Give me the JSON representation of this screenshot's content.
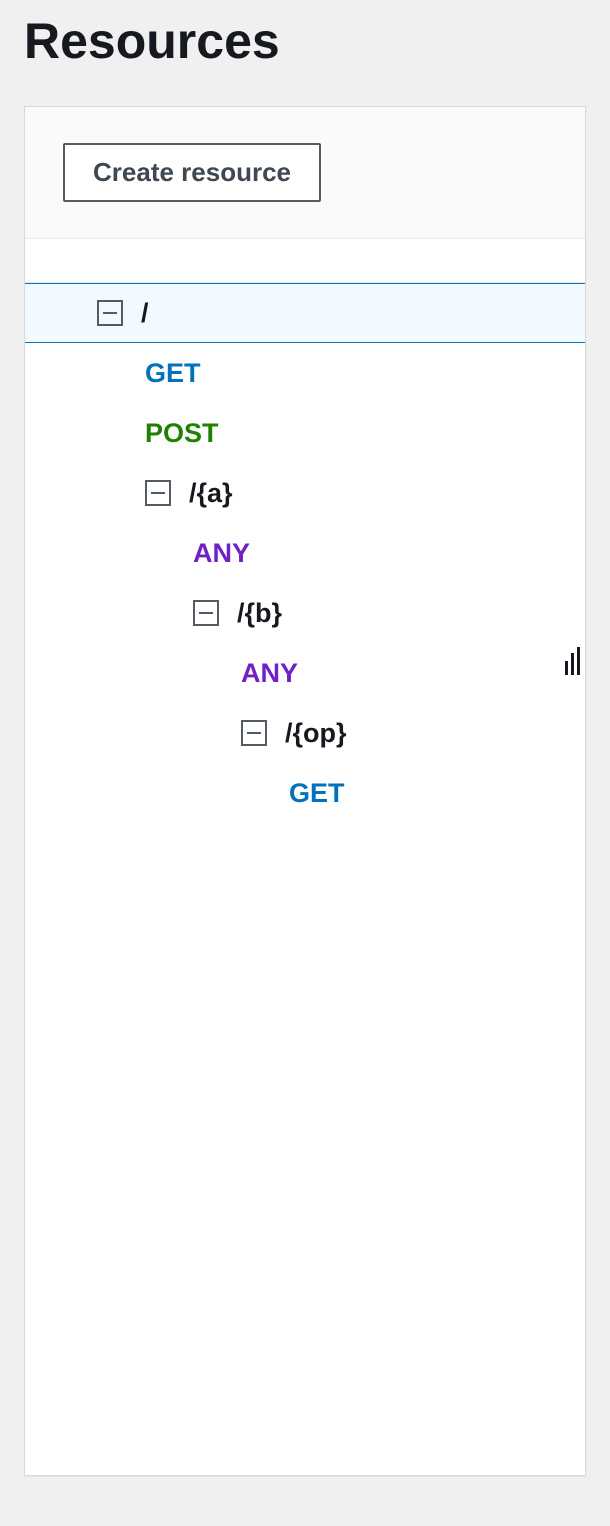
{
  "page_title": "Resources",
  "buttons": {
    "create_resource": "Create resource"
  },
  "tree": [
    {
      "type": "resource",
      "label": "/",
      "indent": 0,
      "selected": true,
      "expanded": true
    },
    {
      "type": "method",
      "label": "GET",
      "indent": 1,
      "method": "GET"
    },
    {
      "type": "method",
      "label": "POST",
      "indent": 1,
      "method": "POST"
    },
    {
      "type": "resource",
      "label": "/{a}",
      "indent": 1,
      "expanded": true
    },
    {
      "type": "method",
      "label": "ANY",
      "indent": 2,
      "method": "ANY"
    },
    {
      "type": "resource",
      "label": "/{b}",
      "indent": 2,
      "expanded": true
    },
    {
      "type": "method",
      "label": "ANY",
      "indent": 3,
      "method": "ANY"
    },
    {
      "type": "resource",
      "label": "/{op}",
      "indent": 3,
      "expanded": true
    },
    {
      "type": "method",
      "label": "GET",
      "indent": 4,
      "method": "GET"
    }
  ]
}
